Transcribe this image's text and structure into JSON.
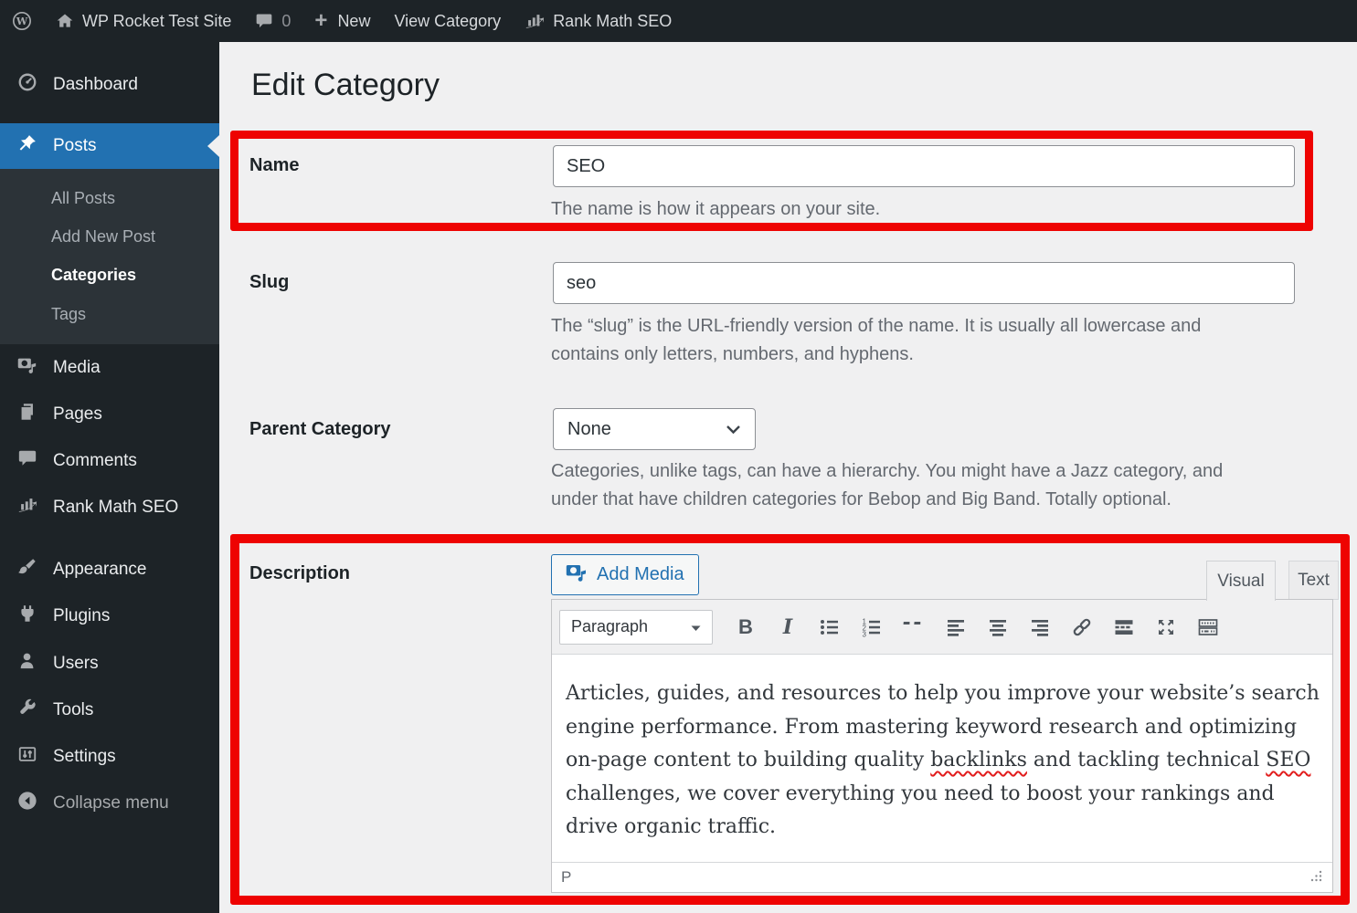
{
  "admin_bar": {
    "site_name": "WP Rocket Test Site",
    "comments_count": "0",
    "new_label": "New",
    "view_category_label": "View Category",
    "rank_math_label": "Rank Math SEO",
    "icons": [
      "wordpress-logo-icon",
      "home-icon",
      "comments-bubble-icon",
      "plus-icon",
      "rank-math-icon"
    ]
  },
  "sidebar": {
    "items": [
      {
        "label": "Dashboard",
        "icon": "dashboard-icon"
      },
      {
        "label": "Posts",
        "icon": "pushpin-icon",
        "active": true
      },
      {
        "label": "Media",
        "icon": "media-icon"
      },
      {
        "label": "Pages",
        "icon": "pages-icon"
      },
      {
        "label": "Comments",
        "icon": "comments-icon"
      },
      {
        "label": "Rank Math SEO",
        "icon": "rank-math-icon"
      },
      {
        "label": "Appearance",
        "icon": "brush-icon"
      },
      {
        "label": "Plugins",
        "icon": "plug-icon"
      },
      {
        "label": "Users",
        "icon": "user-icon"
      },
      {
        "label": "Tools",
        "icon": "wrench-icon"
      },
      {
        "label": "Settings",
        "icon": "settings-icon"
      },
      {
        "label": "Collapse menu",
        "icon": "collapse-arrow-icon"
      }
    ],
    "posts_submenu": [
      "All Posts",
      "Add New Post",
      "Categories",
      "Tags"
    ],
    "current_submenu_item": "Categories"
  },
  "main": {
    "title": "Edit Category",
    "name": {
      "label": "Name",
      "value": "SEO",
      "help": "The name is how it appears on your site."
    },
    "slug": {
      "label": "Slug",
      "value": "seo",
      "help": "The “slug” is the URL-friendly version of the name. It is usually all lowercase and contains only letters, numbers, and hyphens."
    },
    "parent": {
      "label": "Parent Category",
      "value": "None",
      "help": "Categories, unlike tags, can have a hierarchy. You might have a Jazz category, and under that have children categories for Bebop and Big Band. Totally optional."
    },
    "description": {
      "label": "Description",
      "add_media_label": "Add Media",
      "tabs": {
        "visual": "Visual",
        "text": "Text"
      },
      "toolbar": {
        "paragraph_label": "Paragraph",
        "bold_glyph": "B",
        "italic_glyph": "I",
        "quote_glyph": "“",
        "buttons": [
          "bold",
          "italic",
          "bulleted-list",
          "numbered-list",
          "blockquote",
          "align-left",
          "align-center",
          "align-right",
          "link",
          "read-more",
          "fullscreen",
          "toolbar-toggle"
        ]
      },
      "content": {
        "part1": "Articles, guides, and resources to help you improve your website’s search engine performance. From mastering keyword research and optimizing on-page content to building quality ",
        "misspelled1": "backlinks",
        "part2": " and tackling technical ",
        "misspelled2": "SEO",
        "part3": " challenges, we cover everything you need to boost your rankings and drive organic traffic."
      },
      "status_path": "P"
    }
  },
  "colors": {
    "highlight_red": "#ee0302",
    "menu_active_blue": "#2271b1",
    "admin_dark": "#1d2327",
    "submenu_dark": "#2c3338",
    "page_background": "#f0f0f1",
    "help_text": "#646970"
  }
}
